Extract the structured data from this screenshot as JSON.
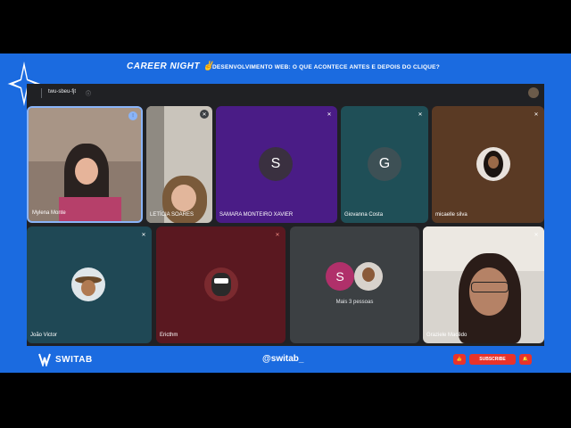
{
  "banner": {
    "brand": "CAREER NIGHT ✌",
    "title": "DESENVOLVIMENTO WEB: O QUE ACONTECE ANTES E DEPOIS DO CLIQUE?"
  },
  "meet": {
    "meeting_code": "twu-sbeu-fjt",
    "info_icon": "info-icon"
  },
  "participants": [
    {
      "name": "Mylena Monte",
      "mic": "active"
    },
    {
      "name": "LETÍCIA SOARES",
      "mic": "muted"
    },
    {
      "name": "SAMARA MONTEIRO XAVIER",
      "initial": "S",
      "mic": "muted"
    },
    {
      "name": "Giovanna Costa",
      "initial": "G",
      "mic": "muted"
    },
    {
      "name": "micaelle silva",
      "mic": "muted"
    },
    {
      "name": "João Victor",
      "mic": "muted"
    },
    {
      "name": "Ericthm",
      "mic": "muted"
    },
    {
      "name": "Graziele Macêdo",
      "mic": "muted"
    }
  ],
  "more_people": {
    "initial": "S",
    "label": "Mais 3 pessoas"
  },
  "footer": {
    "logo": "SWITAB",
    "handle": "@switab_",
    "like_icon": "thumbs-up-icon",
    "subscribe": "SUBSCRIBE",
    "bell_icon": "bell-icon"
  },
  "colors": {
    "frame_blue": "#1b6be0",
    "meet_bg": "#202124",
    "subscribe_red": "#e9332a"
  }
}
